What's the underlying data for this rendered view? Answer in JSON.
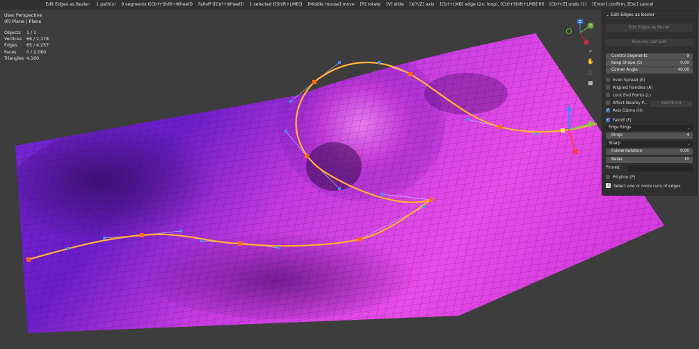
{
  "header": {
    "items": [
      "Edit Edges as Bezier:",
      "1 path(s)",
      "9 segments ([Ctrl+Shift+Wheel])",
      "Falloff ([Ctrl+Wheel])",
      "1 selected ([Shift+LMB])",
      "[Middle mouse] move",
      "[R] rotate",
      "[V] slide",
      "[X/Y/Z] axis",
      "[Ctrl+LMB] edge (2x: loop), [Ctrl+Shift+LMB] fill",
      "[Ctrl+Z] undo (1)",
      "[Enter] confirm, [Esc] cancel"
    ]
  },
  "viewport": {
    "title": "User Perspective",
    "object": "(0) Plane | Plane"
  },
  "stats": [
    {
      "label": "Objects",
      "value": "1 / 1"
    },
    {
      "label": "Vertices",
      "value": "66 / 2,178"
    },
    {
      "label": "Edges",
      "value": "65 / 4,257"
    },
    {
      "label": "Faces",
      "value": "0 / 2,080"
    },
    {
      "label": "Triangles",
      "value": "4,160"
    }
  ],
  "gizmo": {
    "z": "Z",
    "y": "Y"
  },
  "nav": {
    "zoom": "⌕",
    "pan": "✋",
    "camera": "🎥",
    "grid": "▦"
  },
  "panel": {
    "title": "Edit Edges as Bezier",
    "collapse_glyph": "⌄",
    "buttons": {
      "edit": "Edit Edges as Bezier",
      "resume": "Resume Last Edit"
    },
    "props": {
      "control_segments": {
        "label": "Control Segments",
        "value": "9"
      },
      "keep_shape": {
        "label": "Keep Shape (S)",
        "value": "0.00"
      },
      "corner_angle": {
        "label": "Corner Angle",
        "value": "40.00"
      }
    },
    "checks": {
      "even_spread": {
        "label": "Even Spread (E)"
      },
      "aligned_handles": {
        "label": "Aligned Handles (A)"
      },
      "lock_end_points": {
        "label": "Lock End Points (L)"
      },
      "affect_nearby": {
        "label": "Affect Nearby P...",
        "value": "25276 cm"
      },
      "axis_gizmo": {
        "label": "Axis Gizmo (H)"
      },
      "falloff": {
        "label": "Falloff (F)"
      },
      "polyline": {
        "label": "Polyline (P)"
      }
    },
    "falloff_mode": "Edge Rings",
    "rings": {
      "label": "Rings",
      "value": "4"
    },
    "falloff_shape": "Sharp",
    "follow_rotation": {
      "label": "Follow Rotation",
      "value": "0.00"
    },
    "relax": {
      "label": "Relax",
      "value": "10"
    },
    "pinned_label": "Pinned:",
    "info_icon": "i",
    "info": "Select one or more runs of edges"
  },
  "colors": {
    "viewport_bg": "#3d3d3d",
    "mesh_purple": "#8a23e8",
    "mesh_magenta": "#e040e0",
    "curve_orange": "#ff9f2a",
    "control_point": "#ff6a1a",
    "handle_blue": "#3a96ff",
    "panel_bg": "#303030",
    "checkbox_on": "#4772b3"
  }
}
